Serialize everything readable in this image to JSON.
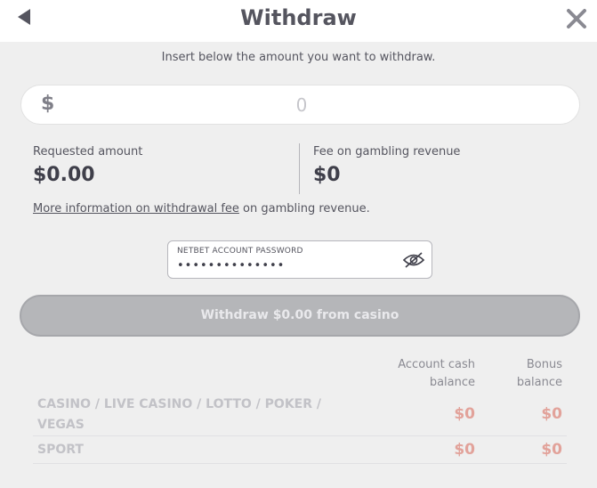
{
  "header": {
    "title": "Withdraw",
    "back_icon": "back-arrow-icon",
    "close_icon": "close-icon"
  },
  "instruction": "Insert below the amount you want to withdraw.",
  "amount": {
    "currency": "$",
    "placeholder": "0",
    "value": ""
  },
  "summary": {
    "requested_label": "Requested amount",
    "requested_value": "$0.00",
    "fee_label": "Fee on gambling revenue",
    "fee_value": "$0"
  },
  "fee_info": {
    "link_text": "More information on withdrawal fee",
    "suffix": " on gambling revenue."
  },
  "password": {
    "label": "NETBET ACCOUNT PASSWORD",
    "value": "••••••••••••••",
    "toggle_icon": "eye-hidden-icon"
  },
  "withdraw_button": {
    "label": "Withdraw $0.00 from casino"
  },
  "balances": {
    "cash_header": [
      "Account cash",
      "balance"
    ],
    "bonus_header": [
      "Bonus",
      "balance"
    ],
    "rows": [
      {
        "label": "CASINO / LIVE CASINO / LOTTO / POKER / VEGAS",
        "cash": "$0",
        "bonus": "$0"
      },
      {
        "label": "SPORT",
        "cash": "$0",
        "bonus": "$0"
      }
    ]
  },
  "colors": {
    "background": "#efefef",
    "button_disabled": "#b5b6b9",
    "balance_value": "#e2a29a",
    "text": "#3f3f4a"
  }
}
